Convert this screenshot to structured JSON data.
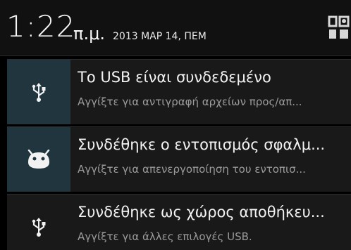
{
  "status_header": {
    "time": "1:22",
    "ampm": "π.μ.",
    "date": "2013 ΜΑΡ 14, ΠΕΜ",
    "settings_icon": "quick-settings-icon"
  },
  "notifications": [
    {
      "icon": "usb-icon",
      "title": "Το USB είναι συνδεδεμένο",
      "text": "Αγγίξτε για αντιγραφή αρχείων προς/απ..."
    },
    {
      "icon": "android-debug-icon",
      "title": "Συνδέθηκε ο εντοπισμός σφαλμ...",
      "text": "Αγγίξτε για απενεργοποίηση του εντοπισ..."
    },
    {
      "icon": "usb-icon",
      "title": "Συνδέθηκε ως χώρος αποθήκευ...",
      "text": "Αγγίξτε για άλλες επιλογές USB."
    }
  ],
  "colors": {
    "background": "#000000",
    "header": "#111111",
    "notification": "#191919",
    "icon_panel": "#20353e",
    "title_text": "#f2f2f2",
    "secondary_text": "#9b9b9b"
  }
}
